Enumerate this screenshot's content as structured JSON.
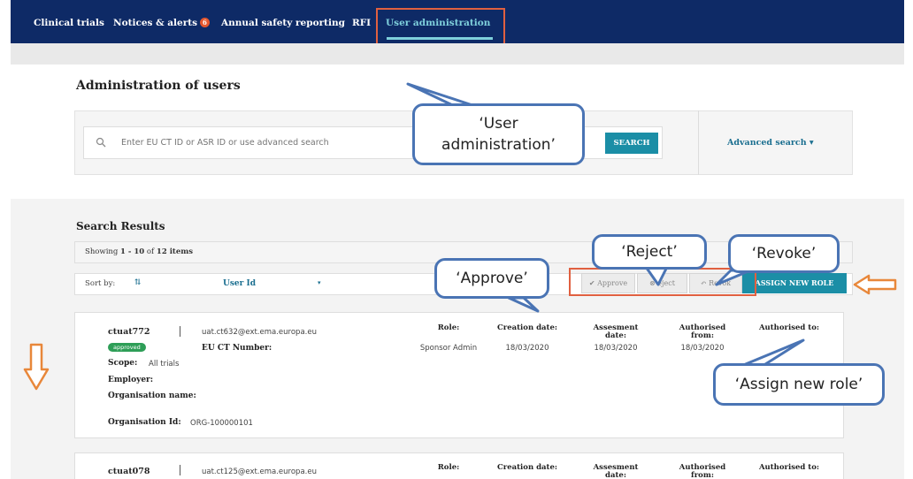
{
  "nav": {
    "clinical_trials": "Clinical trials",
    "notices": "Notices & alerts",
    "notices_count": "6",
    "annual_safety": "Annual safety reporting",
    "rfi": "RFI",
    "user_admin": "User administration"
  },
  "page": {
    "title": "Administration of users"
  },
  "search": {
    "placeholder": "Enter EU CT ID or ASR ID or use advanced search",
    "button": "SEARCH",
    "advanced": "Advanced search ▾"
  },
  "results": {
    "title": "Search Results",
    "showing_prefix": "Showing ",
    "showing_range": "1 - 10",
    "showing_of": " of ",
    "showing_total": "12 items",
    "sort_by": "Sort by:",
    "sort_arrows": "⇅",
    "sort_value": "User Id",
    "sort_caret": "▾"
  },
  "actions": {
    "approve": "✔ Approve",
    "reject": "⊗ eject",
    "revoke": "↶ Revok",
    "assign": "ASSIGN NEW ROLE"
  },
  "cards": [
    {
      "user_id": "ctuat772",
      "email": "uat.ct632@ext.ema.europa.eu",
      "status": "approved",
      "eu_ct_label": "EU CT Number:",
      "scope_label": "Scope:",
      "scope_value": "All trials",
      "employer_label": "Employer:",
      "org_name_label": "Organisation name:",
      "org_id_label": "Organisation Id:",
      "org_id_value": "ORG-100000101",
      "role_label": "Role:",
      "role_value": "Sponsor Admin",
      "creation_label": "Creation date:",
      "creation_value": "18/03/2020",
      "assesment_label1": "Assesment",
      "assesment_label2": "date:",
      "assesment_value": "18/03/2020",
      "auth_from_label1": "Authorised",
      "auth_from_label2": "from:",
      "auth_from_value": "18/03/2020",
      "auth_to_label": "Authorised to:"
    },
    {
      "user_id": "ctuat078",
      "email": "uat.ct125@ext.ema.europa.eu",
      "role_label": "Role:",
      "creation_label": "Creation date:",
      "assesment_label1": "Assesment",
      "assesment_label2": "date:",
      "auth_from_label1": "Authorised",
      "auth_from_label2": "from:",
      "auth_to_label": "Authorised to:"
    }
  ],
  "callouts": {
    "user_admin_line1": "‘User",
    "user_admin_line2": "administration’",
    "reject": "‘Reject’",
    "revoke": "‘Revoke’",
    "approve": "‘Approve’",
    "assign": "‘Assign new role’"
  },
  "colors": {
    "nav_bg": "#0e2a66",
    "accent": "#1b8ea6",
    "highlight": "#e06040",
    "callout_border": "#4a74b4",
    "arrow": "#e8873a"
  }
}
